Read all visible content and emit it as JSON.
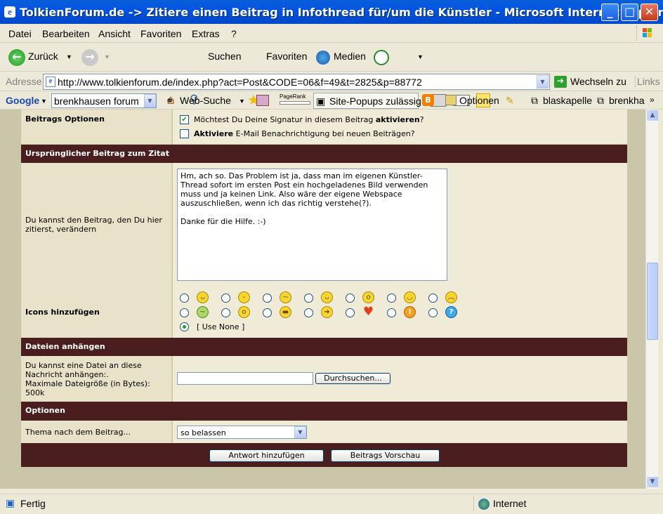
{
  "window": {
    "title": "TolkienForum.de -> Zitiere einen Beitrag in Infothread für/um die Künstler - Microsoft Internet Explorer"
  },
  "menu": [
    "Datei",
    "Bearbeiten",
    "Ansicht",
    "Favoriten",
    "Extras",
    "?"
  ],
  "toolbar": {
    "back": "Zurück",
    "search": "Suchen",
    "favorites": "Favoriten",
    "media": "Medien"
  },
  "address": {
    "label": "Adresse",
    "url": "http://www.tolkienforum.de/index.php?act=Post&CODE=06&f=49&t=2825&p=88772",
    "go": "Wechseln zu",
    "links": "Links"
  },
  "google": {
    "logo": "Google",
    "query": "brenkhausen forum",
    "websearch": "Web-Suche",
    "pagerank": "PageRank",
    "popups": "Site-Popups zulässig",
    "options": "Optionen",
    "bm1": "blaskapelle",
    "bm2": "brenkha"
  },
  "form": {
    "beitrags_optionen": "Beitrags Optionen",
    "signature_pre": "Möchtest Du Deine Signatur in diesem Beitrag ",
    "signature_bold": "aktivieren",
    "signature_post": "?",
    "email_bold": "Aktiviere",
    "email_post": " E-Mail Benachrichtigung bei neuen Beiträgen?",
    "orig_header": "Ursprünglicher Beitrag zum Zitat",
    "orig_label": "Du kannst den Beitrag, den Du hier zitierst, verändern",
    "orig_text": "Hm, ach so. Das Problem ist ja, dass man im eigenen Künstler-Thread sofort im ersten Post ein hochgeladenes Bild verwenden muss und ja keinen Link. Also wäre der eigene Webspace auszuschließen, wenn ich das richtig verstehe(?).\n\nDanke für die Hilfe. :-)",
    "icons_label": "Icons hinzufügen",
    "use_none": "[ Use None ]",
    "attach_header": "Dateien anhängen",
    "attach_label1": "Du kannst eine Datei an diese Nachricht anhängen:.",
    "attach_label2": "Maximale Dateigröße (in Bytes): 500k",
    "browse": "Durchsuchen...",
    "options_header": "Optionen",
    "thema_label": "Thema nach dem Beitrag...",
    "thema_value": "so belassen",
    "submit": "Antwort hinzufügen",
    "preview": "Beitrags Vorschau"
  },
  "icons": [
    "smile",
    "neutral",
    "smirk",
    "wink",
    "surprised",
    "grin",
    "angry",
    "sick",
    "worried",
    "cool",
    "arrow-right",
    "heart",
    "exclamation",
    "question"
  ],
  "status": {
    "left": "Fertig",
    "zone": "Internet"
  },
  "colors": {
    "header_bg": "#4A1E1E",
    "cell_bg": "#EFEBD6",
    "label_bg": "#E8E3C8",
    "titlebar": "#0054E3"
  }
}
